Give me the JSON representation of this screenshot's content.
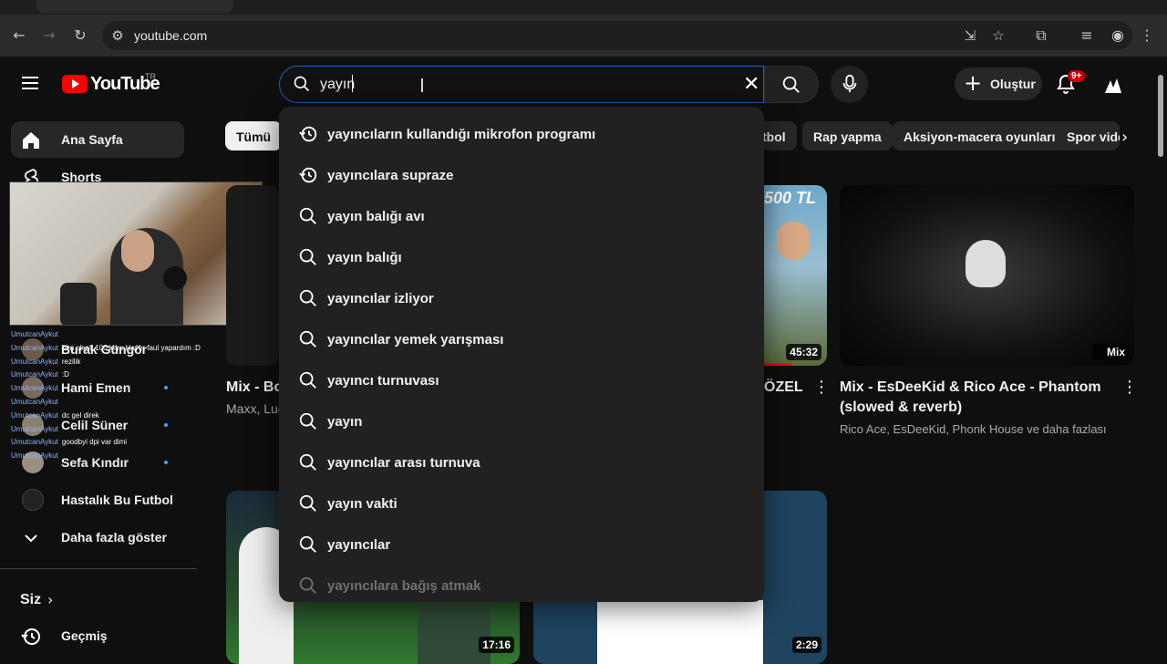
{
  "browser": {
    "url": "youtube.com"
  },
  "header": {
    "logo_text": "YouTube",
    "region": "TR",
    "search_value": "yayın",
    "create_label": "Oluştur",
    "notif_count": "9+"
  },
  "sidebar": {
    "home_label": "Ana Sayfa",
    "shorts_label": "Shorts",
    "subs": [
      {
        "label": "Burak Güngör"
      },
      {
        "label": "Hami Emen"
      },
      {
        "label": "Celil Süner"
      },
      {
        "label": "Sefa Kındır"
      },
      {
        "label": "Hastalık Bu Futbol"
      }
    ],
    "show_more": "Daha fazla göster",
    "siz_label": "Siz",
    "history_label": "Geçmiş"
  },
  "chat": [
    {
      "user": "UmutcanAykut",
      "msg": ""
    },
    {
      "user": "UmutcanAykut",
      "msg": "ben olsalı 100 kere Hayer faul yapardım :D"
    },
    {
      "user": "UmutcanAykut",
      "msg": "rezilik"
    },
    {
      "user": "UmutcanAykut",
      "msg": ":D"
    },
    {
      "user": "UmutcanAykut",
      "msg": ""
    },
    {
      "user": "UmutcanAykut",
      "msg": ""
    },
    {
      "user": "UmutcanAykut",
      "msg": "dc gel direk"
    },
    {
      "user": "UmutcanAykut",
      "msg": ""
    },
    {
      "user": "UmutcanAykut",
      "msg": "goodbyi dpi var dimi"
    },
    {
      "user": "UmutcanAykut",
      "msg": ""
    }
  ],
  "chips": [
    "Tümü",
    "tbol",
    "Rap yapma",
    "Aksiyon-macera oyunları",
    "Spor vide"
  ],
  "suggestions": [
    {
      "text": "yayıncıların kullandığı mikrofon programı",
      "icon": "history-icon"
    },
    {
      "text": "yayıncılara supraze",
      "icon": "history-icon"
    },
    {
      "text": "yayın balığı avı",
      "icon": "search-icon"
    },
    {
      "text": "yayın balığı",
      "icon": "search-icon"
    },
    {
      "text": "yayıncılar izliyor",
      "icon": "search-icon"
    },
    {
      "text": "yayıncılar yemek yarışması",
      "icon": "search-icon"
    },
    {
      "text": "yayıncı turnuvası",
      "icon": "search-icon"
    },
    {
      "text": "yayın",
      "icon": "search-icon"
    },
    {
      "text": "yayıncılar arası turnuva",
      "icon": "search-icon"
    },
    {
      "text": "yayın vakti",
      "icon": "search-icon"
    },
    {
      "text": "yayıncılar",
      "icon": "search-icon"
    },
    {
      "text": "yayıncılara bağış atmak",
      "icon": "search-icon"
    }
  ],
  "videos": [
    {
      "title": "Mix - Boo",
      "meta": "Maxx, Luc"
    },
    {
      "title": "ÖZEL",
      "thumb_text": "500 TL",
      "duration": "45:32"
    },
    {
      "title": "Mix - EsDeeKid & Rico Ace - Phantom",
      "title2": "(slowed & reverb)",
      "meta": "Rico Ace, EsDeeKid, Phonk House ve daha fazlası",
      "badge": "Mix"
    },
    {
      "duration": "17:16"
    },
    {
      "duration": "2:29"
    }
  ]
}
